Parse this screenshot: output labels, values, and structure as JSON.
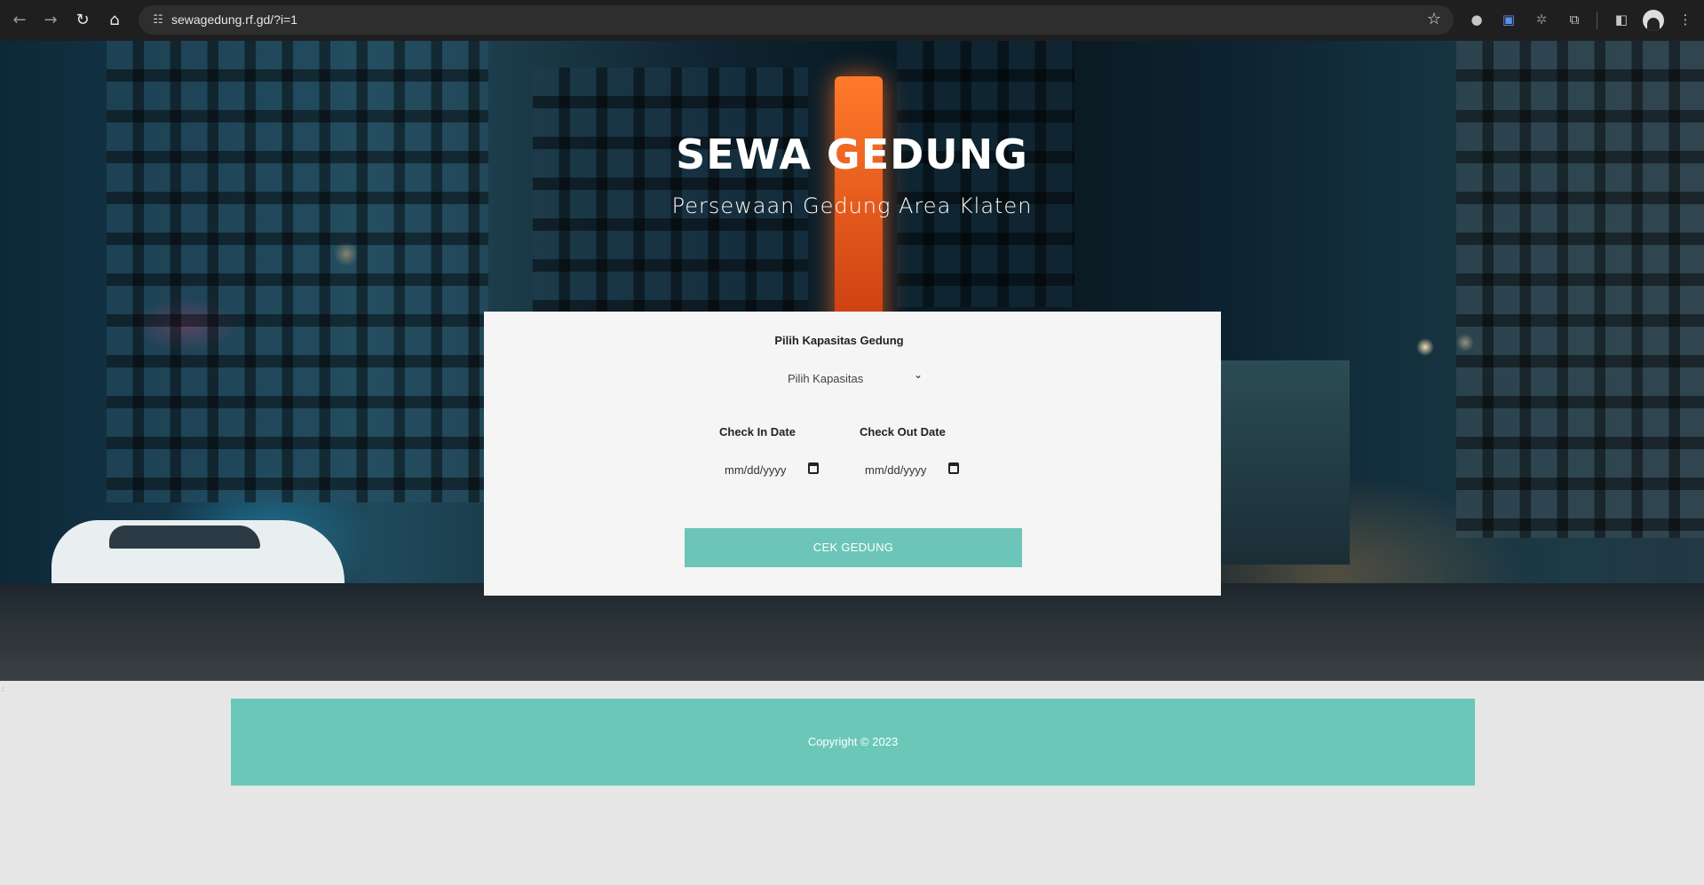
{
  "browser": {
    "url": "sewagedung.rf.gd/?i=1",
    "nav_icons": [
      "back-arrow-icon",
      "forward-arrow-icon",
      "reload-icon",
      "home-icon"
    ],
    "toolbar_icons": [
      "bookmark-star-icon",
      "extension-icon",
      "translate-icon",
      "puzzle-extensions-icon",
      "side-panel-icon",
      "profile-avatar-icon",
      "more-menu-icon"
    ]
  },
  "hero": {
    "title": "SEWA GEDUNG",
    "subtitle": "Persewaan Gedung Area Klaten"
  },
  "form": {
    "capacity_label": "Pilih Kapasitas Gedung",
    "capacity_select_value": "Pilih Kapasitas",
    "checkin_label": "Check In Date",
    "checkin_placeholder": "mm/dd/yyyy",
    "checkout_label": "Check Out Date",
    "checkout_placeholder": "mm/dd/yyyy",
    "submit_label": "CEK GEDUNG"
  },
  "stray_mark": ":",
  "footer": {
    "copyright": "Copyright © 2023"
  },
  "colors": {
    "accent": "#6cc5b8",
    "card": "#f4f5f4",
    "page_bg": "#e6e6e6",
    "chrome_bg": "#1f1f1f"
  }
}
